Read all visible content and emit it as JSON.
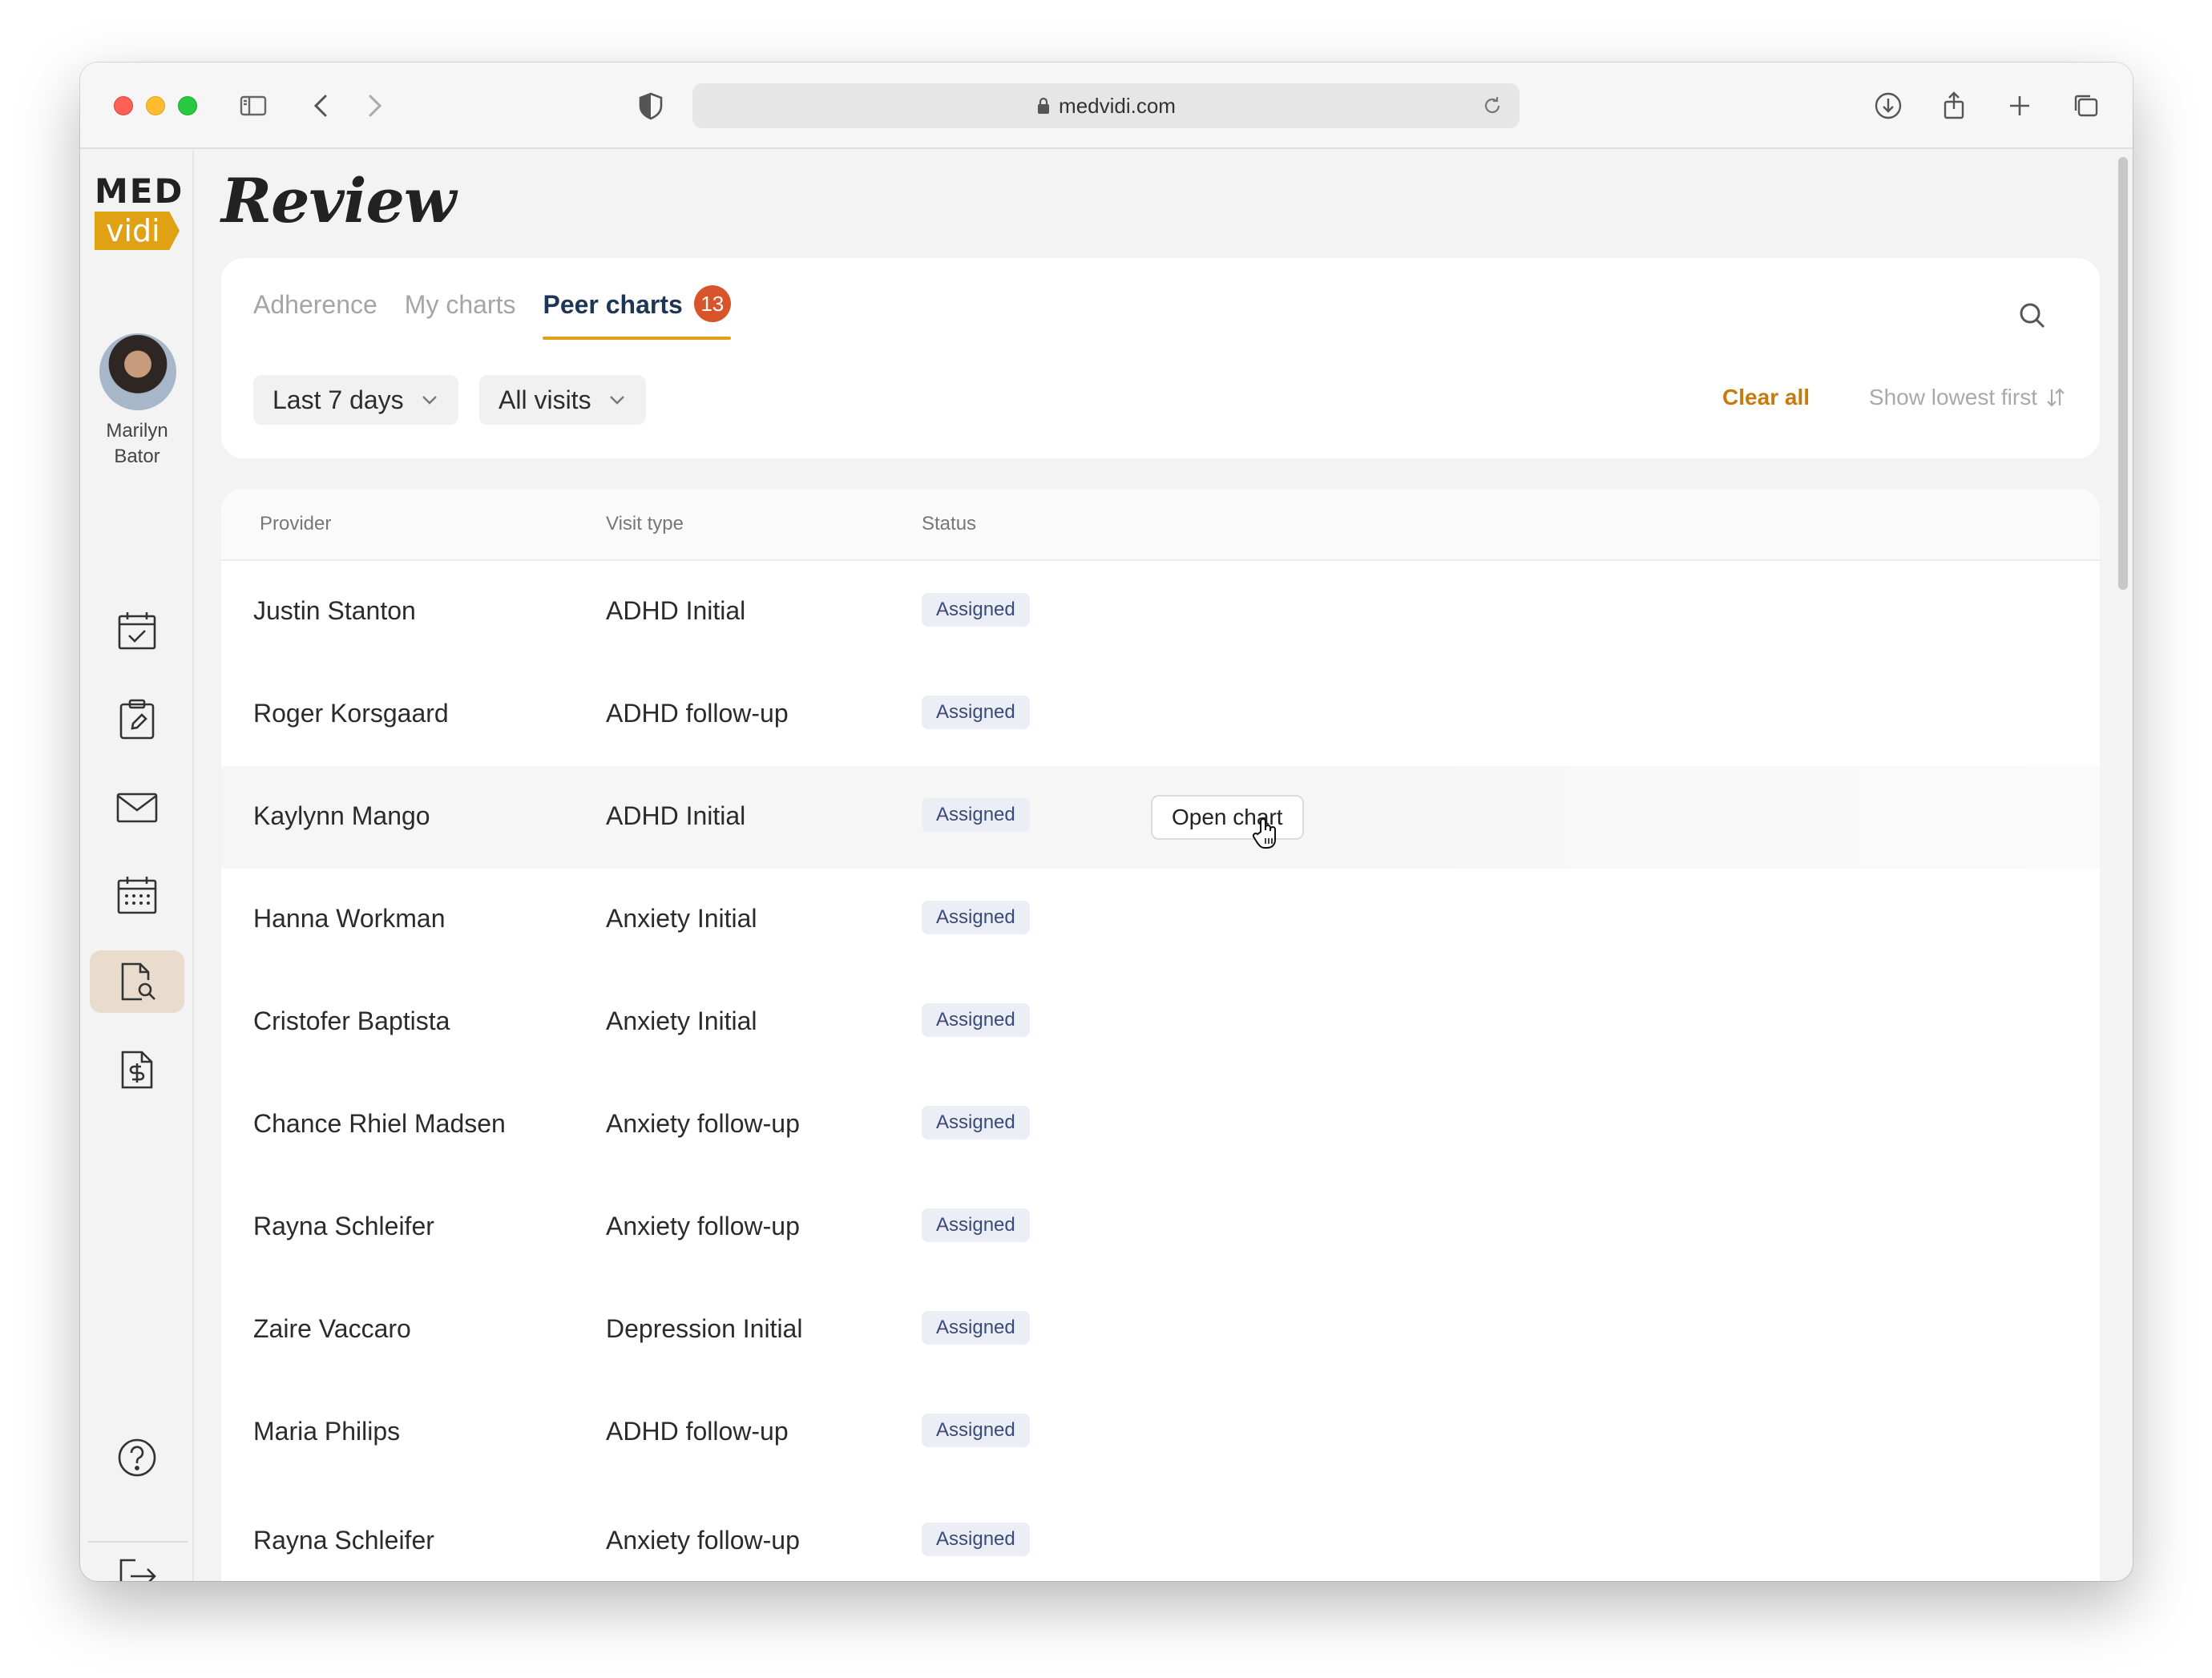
{
  "browser": {
    "url": "medvidi.com"
  },
  "app": {
    "logo_top": "MED",
    "logo_bottom": "vidi",
    "page_title": "Review"
  },
  "user": {
    "name": "Marilyn Bator"
  },
  "sidebar": {
    "items": [
      {
        "icon": "calendar-check-icon"
      },
      {
        "icon": "clipboard-edit-icon"
      },
      {
        "icon": "mail-icon"
      },
      {
        "icon": "calendar-grid-icon"
      },
      {
        "icon": "document-search-icon",
        "active": true
      },
      {
        "icon": "document-dollar-icon"
      }
    ],
    "bottom": [
      {
        "icon": "help-icon"
      },
      {
        "icon": "logout-icon"
      }
    ]
  },
  "tabs": [
    {
      "label": "Adherence"
    },
    {
      "label": "My charts"
    },
    {
      "label": "Peer charts",
      "badge": "13",
      "active": true
    }
  ],
  "filters": {
    "period": "Last 7 days",
    "visits": "All visits",
    "clear_all": "Clear all",
    "sort": "Show lowest first"
  },
  "table": {
    "columns": [
      "Provider",
      "Visit type",
      "Status"
    ],
    "rows": [
      {
        "provider": "Justin Stanton",
        "visit_type": "ADHD Initial",
        "status": "Assigned"
      },
      {
        "provider": "Roger Korsgaard",
        "visit_type": "ADHD follow-up",
        "status": "Assigned"
      },
      {
        "provider": "Kaylynn Mango",
        "visit_type": "ADHD Initial",
        "status": "Assigned",
        "action": "Open chart"
      },
      {
        "provider": "Hanna Workman",
        "visit_type": "Anxiety Initial",
        "status": "Assigned"
      },
      {
        "provider": "Cristofer Baptista",
        "visit_type": "Anxiety Initial",
        "status": "Assigned"
      },
      {
        "provider": "Chance Rhiel Madsen",
        "visit_type": "Anxiety follow-up",
        "status": "Assigned"
      },
      {
        "provider": "Rayna Schleifer",
        "visit_type": "Anxiety follow-up",
        "status": "Assigned"
      },
      {
        "provider": "Zaire Vaccaro",
        "visit_type": "Depression Initial",
        "status": "Assigned"
      },
      {
        "provider": "Maria Philips",
        "visit_type": "ADHD follow-up",
        "status": "Assigned"
      },
      {
        "provider": "Rayna Schleifer",
        "visit_type": "Anxiety follow-up",
        "status": "Assigned"
      }
    ]
  },
  "colors": {
    "accent": "#e0a114",
    "badge": "#d8542a",
    "link": "#c87a0c",
    "tab_active": "#1e3553",
    "status_bg": "#eceef6"
  }
}
